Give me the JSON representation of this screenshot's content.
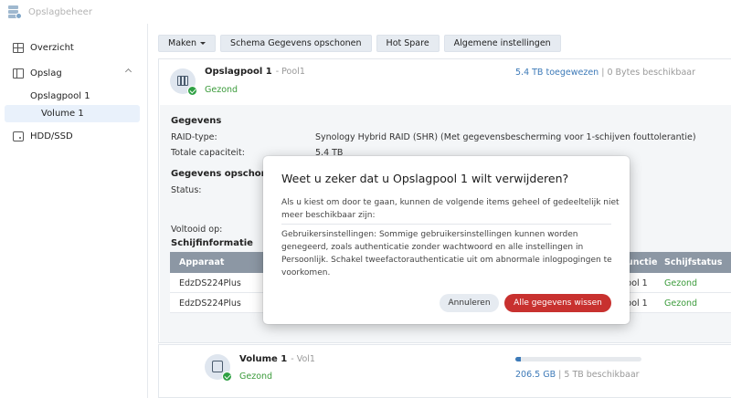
{
  "app": {
    "title": "Opslagbeheer",
    "icon": "storage-manager-icon"
  },
  "sidebar": {
    "items": [
      {
        "label": "Overzicht",
        "icon": "overview-icon"
      },
      {
        "label": "Opslag",
        "icon": "storage-icon"
      },
      {
        "label": "HDD/SSD",
        "icon": "disk-icon"
      }
    ],
    "subitems": [
      {
        "label": "Opslagpool 1"
      },
      {
        "label": "Volume 1",
        "selected": true
      }
    ]
  },
  "toolbar": {
    "create_label": "Maken",
    "scrub_label": "Schema Gegevens opschonen",
    "hotspare_label": "Hot Spare",
    "settings_label": "Algemene instellingen"
  },
  "pool": {
    "name": "Opslagpool 1",
    "sub": "- Pool1",
    "status": "Gezond",
    "allocated": "5.4 TB toegewezen",
    "separator": "|",
    "available": "0 Bytes beschikbaar",
    "details_title": "Gegevens",
    "raid_label": "RAID-type:",
    "raid_value": "Synology Hybrid RAID (SHR) (Met gegevensbescherming voor 1-schijven fouttolerantie)",
    "capacity_label": "Totale capaciteit:",
    "capacity_value": "5.4 TB",
    "scrub_title": "Gegevens opschon",
    "status_label": "Status:",
    "completed_label": "Voltooid op:",
    "disk_title": "Schijfinformatie",
    "table": {
      "headers": [
        "Apparaat",
        "Functie",
        "Schijfstatus"
      ],
      "rows": [
        [
          "EdzDS224Plus",
          "Pool 1",
          "Gezond"
        ],
        [
          "EdzDS224Plus",
          "Pool 1",
          "Gezond"
        ]
      ]
    }
  },
  "volume": {
    "name": "Volume 1",
    "sub": "- Vol1",
    "status": "Gezond",
    "used": "206.5 GB",
    "separator": "|",
    "capacity": "5 TB beschikbaar",
    "usage_fraction": 0.04
  },
  "modal": {
    "title": "Weet u zeker dat u Opslagpool 1 wilt verwijderen?",
    "text1": "Als u kiest om door te gaan, kunnen de volgende items geheel of gedeeltelijk niet meer beschikbaar zijn:",
    "text2": "Gebruikersinstellingen: Sommige gebruikersinstellingen kunnen worden genegeerd, zoals authenticatie zonder wachtwoord en alle instellingen in Persoonlijk. Schakel tweefactorauthenticatie uit om abnormale inlogpogingen te voorkomen.",
    "cancel_label": "Annuleren",
    "confirm_label": "Alle gegevens wissen"
  },
  "colors": {
    "accent": "#3d7ab8",
    "healthy": "#3b9b3b",
    "danger": "#c8312f",
    "table_header": "#8c97a4"
  }
}
